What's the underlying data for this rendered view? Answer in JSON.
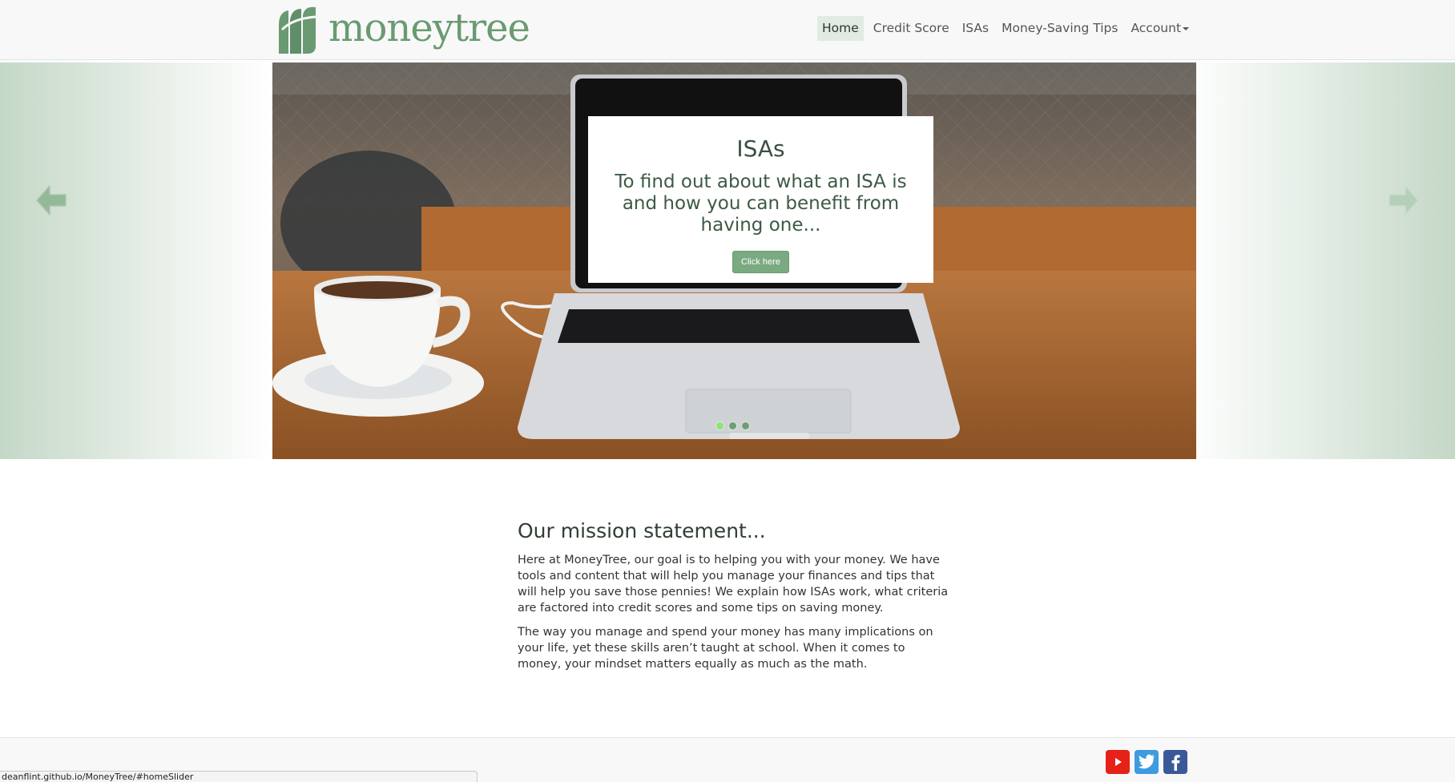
{
  "brand": {
    "name": "moneytree",
    "color": "#6a9a72"
  },
  "nav": {
    "items": [
      {
        "label": "Home",
        "active": true
      },
      {
        "label": "Credit Score",
        "active": false
      },
      {
        "label": "ISAs",
        "active": false
      },
      {
        "label": "Money-Saving Tips",
        "active": false
      },
      {
        "label": "Account",
        "active": false,
        "dropdown": true
      }
    ]
  },
  "slider": {
    "prev_icon": "arrow-left-icon",
    "next_icon": "arrow-right-icon",
    "slide": {
      "title": "ISAs",
      "text": "To find out about what an ISA is and how you can benefit from having one...",
      "button_label": "Click here"
    },
    "indicators": [
      {
        "active": true
      },
      {
        "active": false
      },
      {
        "active": false
      }
    ],
    "accent_color": "#7aaa82"
  },
  "mission": {
    "heading": "Our mission statement...",
    "paragraphs": [
      "Here at MoneyTree, our goal is to helping you with your money. We have tools and content that will help you manage your finances and tips that will help you save those pennies! We explain how ISAs work, what criteria are factored into credit scores and some tips on saving money.",
      "The way you manage and spend your money has many implications on your life, yet these skills aren’t taught at school. When it comes to money, your mindset matters equally as much as the math."
    ]
  },
  "footer": {
    "social": [
      {
        "name": "youtube-icon",
        "color": "#e62117"
      },
      {
        "name": "twitter-icon",
        "color": "#3d9be0"
      },
      {
        "name": "facebook-icon",
        "color": "#3b5998"
      }
    ]
  },
  "status_bar": {
    "url": "deanflint.github.io/MoneyTree/#homeSlider"
  }
}
